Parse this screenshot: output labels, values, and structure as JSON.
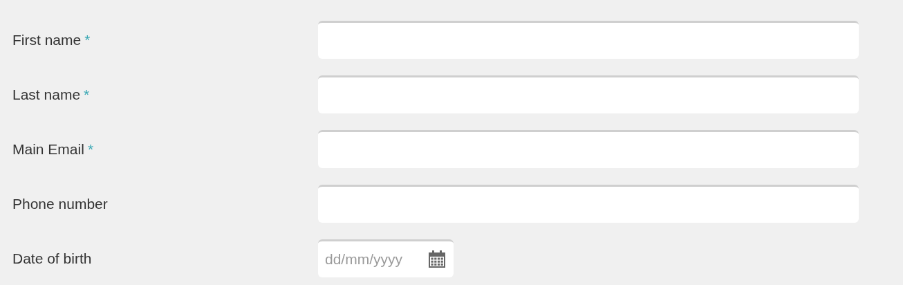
{
  "fields": [
    {
      "label": "First name",
      "required": true,
      "kind": "text"
    },
    {
      "label": "Last name",
      "required": true,
      "kind": "text"
    },
    {
      "label": "Main Email",
      "required": true,
      "kind": "text"
    },
    {
      "label": "Phone number",
      "required": false,
      "kind": "text"
    },
    {
      "label": "Date of birth",
      "required": false,
      "kind": "date",
      "placeholder": "dd/mm/yyyy"
    }
  ],
  "required_mark": "*"
}
